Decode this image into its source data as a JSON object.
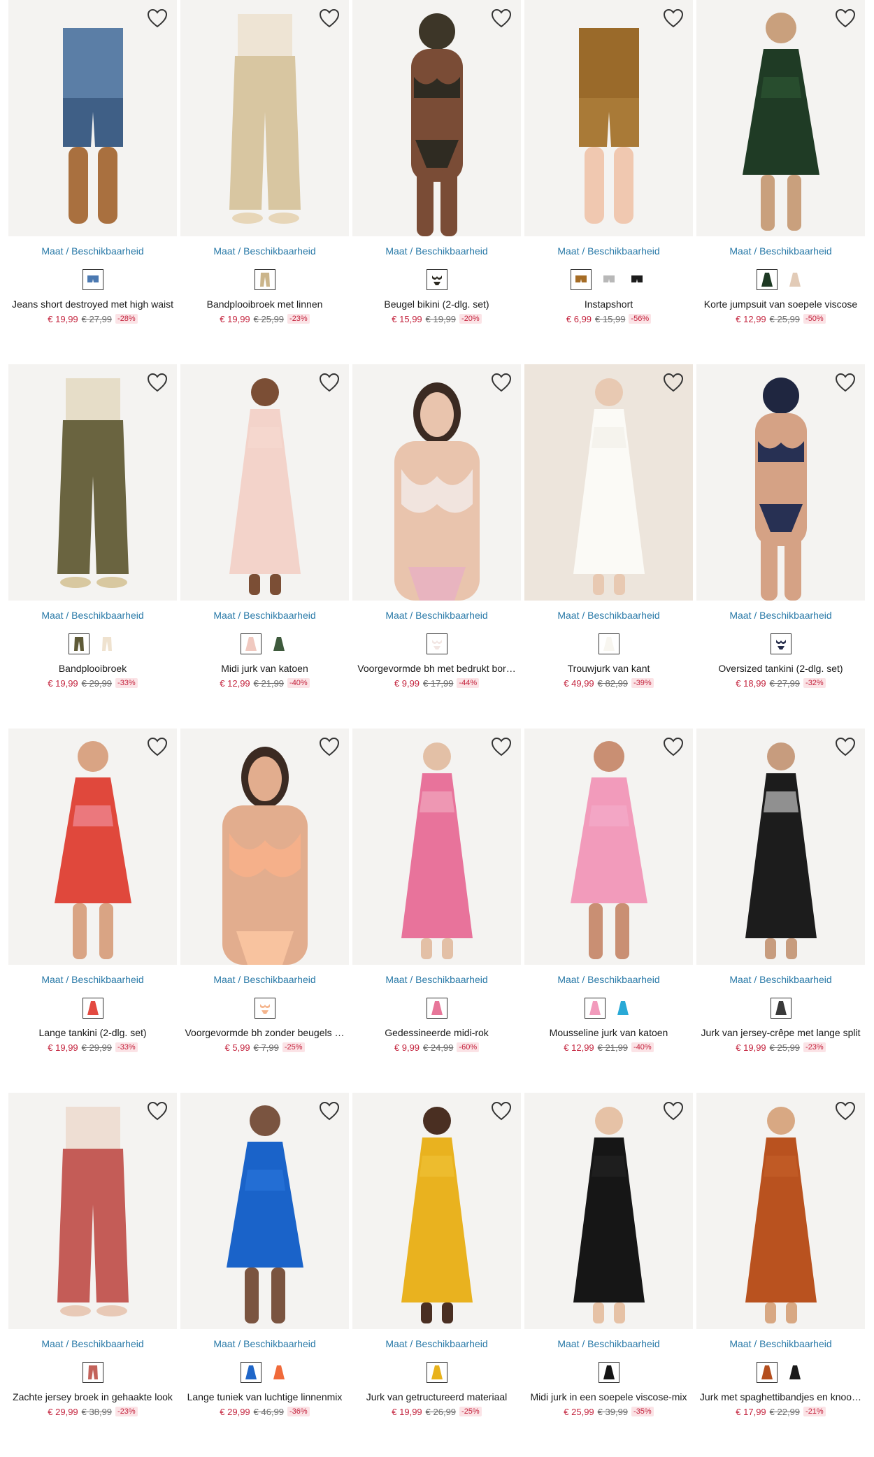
{
  "size_link_label": "Maat / Beschikbaarheid",
  "products": [
    {
      "title": "Jeans short destroyed met high waist",
      "price": "€ 19,99",
      "old_price": "€ 27,99",
      "discount": "-28%",
      "bg": "#f4f3f1",
      "colors": [
        "#5b7ea6",
        "#3f5f86",
        "#a9703f"
      ],
      "swatches": [
        "#4b79b1"
      ],
      "kind": "shorts"
    },
    {
      "title": "Bandplooibroek met linnen",
      "price": "€ 19,99",
      "old_price": "€ 25,99",
      "discount": "-23%",
      "bg": "#f4f3f1",
      "colors": [
        "#d8c6a1",
        "#d8c6a1",
        "#e7d6b8"
      ],
      "swatches": [
        "#cbb58b"
      ],
      "kind": "trousers"
    },
    {
      "title": "Beugel bikini (2-dlg. set)",
      "price": "€ 15,99",
      "old_price": "€ 19,99",
      "discount": "-20%",
      "bg": "#f4f3f1",
      "colors": [
        "#2f2b22",
        "#3d3628",
        "#7a4c36"
      ],
      "swatches": [
        "#2c2a22"
      ],
      "kind": "bikini"
    },
    {
      "title": "Instapshort",
      "price": "€ 6,99",
      "old_price": "€ 15,99",
      "discount": "-56%",
      "bg": "#f4f3f1",
      "colors": [
        "#9a6a2a",
        "#a97a37",
        "#f0c8b0"
      ],
      "swatches": [
        "#a56c26",
        "#b8b8b8",
        "#1c1c1c"
      ],
      "kind": "shorts"
    },
    {
      "title": "Korte jumpsuit van soepele viscose",
      "price": "€ 12,99",
      "old_price": "€ 25,99",
      "discount": "-50%",
      "bg": "#f4f3f1",
      "colors": [
        "#1f3b25",
        "#2f5a36",
        "#c9a07d"
      ],
      "swatches": [
        "#1e3a24",
        "#e2cbb7"
      ],
      "kind": "dress-short"
    },
    {
      "title": "Bandplooibroek",
      "price": "€ 19,99",
      "old_price": "€ 29,99",
      "discount": "-33%",
      "bg": "#f4f3f1",
      "colors": [
        "#6a6440",
        "#5b5535",
        "#d8c8a0"
      ],
      "swatches": [
        "#5e5a37",
        "#efe2cf"
      ],
      "kind": "trousers"
    },
    {
      "title": "Midi jurk van katoen",
      "price": "€ 12,99",
      "old_price": "€ 21,99",
      "discount": "-40%",
      "bg": "#f4f3f1",
      "colors": [
        "#f3d3ca",
        "#f6dbd2",
        "#7b4e35"
      ],
      "swatches": [
        "#f0c9c0",
        "#3e5a3c"
      ],
      "kind": "dress-long"
    },
    {
      "title": "Voorgevormde bh met bedrukt bor…",
      "price": "€ 9,99",
      "old_price": "€ 17,99",
      "discount": "-44%",
      "bg": "#f4f3f1",
      "colors": [
        "#f1e4de",
        "#e8b4bf",
        "#e9c4ad"
      ],
      "swatches": [
        "#f2e6e3"
      ],
      "kind": "bra"
    },
    {
      "title": "Trouwjurk van kant",
      "price": "€ 49,99",
      "old_price": "€ 82,99",
      "discount": "-39%",
      "bg": "#ede5dc",
      "colors": [
        "#fbfaf6",
        "#f1ede6",
        "#e8c9b2"
      ],
      "swatches": [
        "#f8f6f0"
      ],
      "kind": "dress-long"
    },
    {
      "title": "Oversized tankini (2-dlg. set)",
      "price": "€ 18,99",
      "old_price": "€ 27,99",
      "discount": "-32%",
      "bg": "#f4f3f1",
      "colors": [
        "#273053",
        "#1f2640",
        "#d5a285"
      ],
      "swatches": [
        "#252c4a"
      ],
      "kind": "bikini"
    },
    {
      "title": "Lange tankini (2-dlg. set)",
      "price": "€ 19,99",
      "old_price": "€ 29,99",
      "discount": "-33%",
      "bg": "#f4f3f1",
      "colors": [
        "#e0483c",
        "#f29aa8",
        "#d9a484"
      ],
      "swatches": [
        "#e34a41"
      ],
      "kind": "dress-short"
    },
    {
      "title": "Voorgevormde bh zonder beugels …",
      "price": "€ 5,99",
      "old_price": "€ 7,99",
      "discount": "-25%",
      "bg": "#f4f3f1",
      "colors": [
        "#f5b08a",
        "#f8c39f",
        "#e2ad8e"
      ],
      "swatches": [
        "#f4b48c"
      ],
      "kind": "bra"
    },
    {
      "title": "Gedessineerde midi-rok",
      "price": "€ 9,99",
      "old_price": "€ 24,99",
      "discount": "-60%",
      "bg": "#f4f3f1",
      "colors": [
        "#e8739b",
        "#f2b4c6",
        "#e3c0a6"
      ],
      "swatches": [
        "#e77699"
      ],
      "kind": "dress-long"
    },
    {
      "title": "Mousseline jurk van katoen",
      "price": "€ 12,99",
      "old_price": "€ 21,99",
      "discount": "-40%",
      "bg": "#f4f3f1",
      "colors": [
        "#f29bbb",
        "#f4aecb",
        "#c98f73"
      ],
      "swatches": [
        "#f29bbc",
        "#29a9d6"
      ],
      "kind": "dress-short"
    },
    {
      "title": "Jurk van jersey-crêpe met lange split",
      "price": "€ 19,99",
      "old_price": "€ 25,99",
      "discount": "-23%",
      "bg": "#f4f3f1",
      "colors": [
        "#1c1c1c",
        "#f1f1f1",
        "#c79c7e"
      ],
      "swatches": [
        "#3a3a3a"
      ],
      "kind": "dress-long"
    },
    {
      "title": "Zachte jersey broek in gehaakte look",
      "price": "€ 29,99",
      "old_price": "€ 38,99",
      "discount": "-23%",
      "bg": "#f4f3f1",
      "colors": [
        "#c45c57",
        "#e58c84",
        "#e8c9b6"
      ],
      "swatches": [
        "#c3625a"
      ],
      "kind": "trousers"
    },
    {
      "title": "Lange tuniek van luchtige linnenmix",
      "price": "€ 29,99",
      "old_price": "€ 46,99",
      "discount": "-36%",
      "bg": "#f4f3f1",
      "colors": [
        "#1a63c9",
        "#2a77dc",
        "#7a5440"
      ],
      "swatches": [
        "#1f66c8",
        "#f06a3a"
      ],
      "kind": "dress-short"
    },
    {
      "title": "Jurk van getructureerd materiaal",
      "price": "€ 19,99",
      "old_price": "€ 26,99",
      "discount": "-25%",
      "bg": "#f4f3f1",
      "colors": [
        "#e9b21f",
        "#f0c43a",
        "#4a2f22"
      ],
      "swatches": [
        "#e8b21b"
      ],
      "kind": "dress-long"
    },
    {
      "title": "Midi jurk in een soepele viscose-mix",
      "price": "€ 25,99",
      "old_price": "€ 39,99",
      "discount": "-35%",
      "bg": "#f4f3f1",
      "colors": [
        "#161616",
        "#262626",
        "#e6c2a6"
      ],
      "swatches": [
        "#151515"
      ],
      "kind": "dress-long"
    },
    {
      "title": "Jurk met spaghettibandjes en knoo…",
      "price": "€ 17,99",
      "old_price": "€ 22,99",
      "discount": "-21%",
      "bg": "#f4f3f1",
      "colors": [
        "#b9521f",
        "#c6602a",
        "#d8a883"
      ],
      "swatches": [
        "#b44e1e",
        "#1a1a1a"
      ],
      "kind": "dress-long"
    }
  ]
}
